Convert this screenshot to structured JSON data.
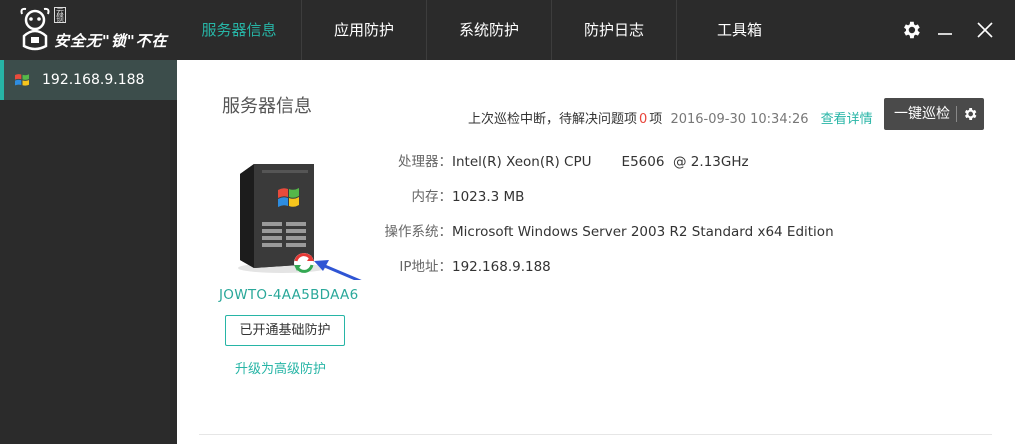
{
  "app": {
    "logo_text": "安全无\"锁\"不在",
    "logo_stamp": "云锁",
    "accent_color": "#27b5a6",
    "alert_color": "#e8443a"
  },
  "nav": {
    "items": [
      {
        "label": "服务器信息",
        "active": true
      },
      {
        "label": "应用防护",
        "active": false
      },
      {
        "label": "系统防护",
        "active": false
      },
      {
        "label": "防护日志",
        "active": false
      },
      {
        "label": "工具箱",
        "active": false
      }
    ],
    "controls": [
      "gear-icon",
      "minimize-icon",
      "close-icon"
    ]
  },
  "sidebar": {
    "hosts": [
      {
        "label": "192.168.9.188",
        "icon": "windows-icon",
        "selected": true
      }
    ]
  },
  "main": {
    "title": "服务器信息",
    "status": {
      "prefix": "上次巡检中断，待解决问题项",
      "count": "0",
      "suffix": "项",
      "time": "2016-09-30 10:34:26",
      "detail_link": "查看详情"
    },
    "scan_button": {
      "label": "一键巡检",
      "icon": "gear-icon"
    },
    "host_name": "JOWTO-4AA5BDAA6",
    "protect_button": "已开通基础防护",
    "upgrade_link": "升级为高级防护",
    "info": [
      {
        "key": "处理器：",
        "value": "Intel(R) Xeon(R) CPU       E5606  @ 2.13GHz"
      },
      {
        "key": "内存：",
        "value": "1023.3 MB"
      },
      {
        "key": "操作系统：",
        "value": "Microsoft Windows Server 2003 R2 Standard x64 Edition"
      },
      {
        "key": "IP地址：",
        "value": "192.168.9.188"
      }
    ]
  }
}
